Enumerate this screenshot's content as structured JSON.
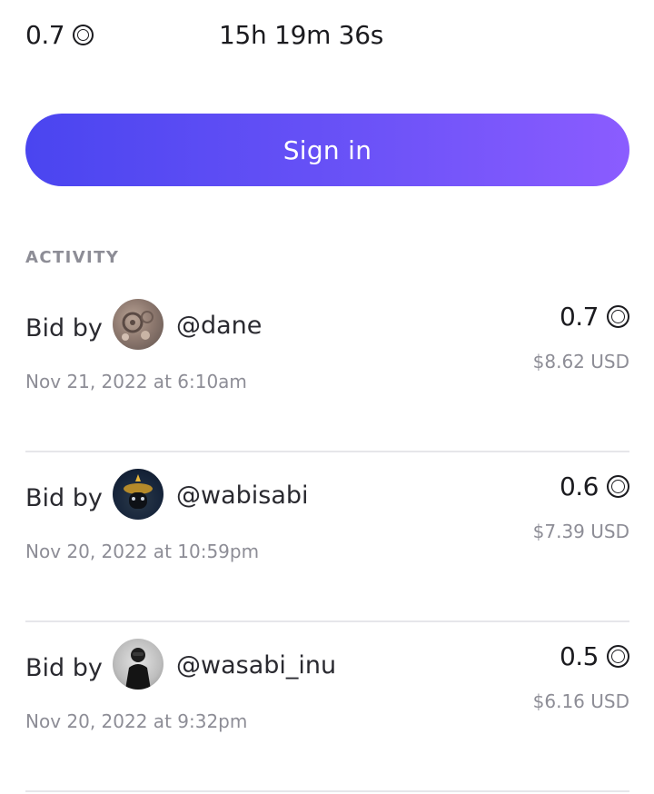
{
  "header": {
    "price": "0.7",
    "price_icon": "coin-icon",
    "timer": "15h 19m 36s"
  },
  "signin": {
    "label": "Sign in"
  },
  "activity": {
    "title": "ACTIVITY",
    "items": [
      {
        "prefix": "Bid by",
        "user": "@dane",
        "date": "Nov 21, 2022 at 6:10am",
        "amount": "0.7",
        "usd": "$8.62 USD",
        "avatar": "avatar-dane"
      },
      {
        "prefix": "Bid by",
        "user": "@wabisabi",
        "date": "Nov 20, 2022 at 10:59pm",
        "amount": "0.6",
        "usd": "$7.39 USD",
        "avatar": "avatar-wabisabi"
      },
      {
        "prefix": "Bid by",
        "user": "@wasabi_inu",
        "date": "Nov 20, 2022 at 9:32pm",
        "amount": "0.5",
        "usd": "$6.16 USD",
        "avatar": "avatar-wasabi-inu"
      }
    ]
  },
  "colors": {
    "accent_start": "#4a45f0",
    "accent_end": "#8b5cff",
    "muted": "#8d8d96"
  }
}
